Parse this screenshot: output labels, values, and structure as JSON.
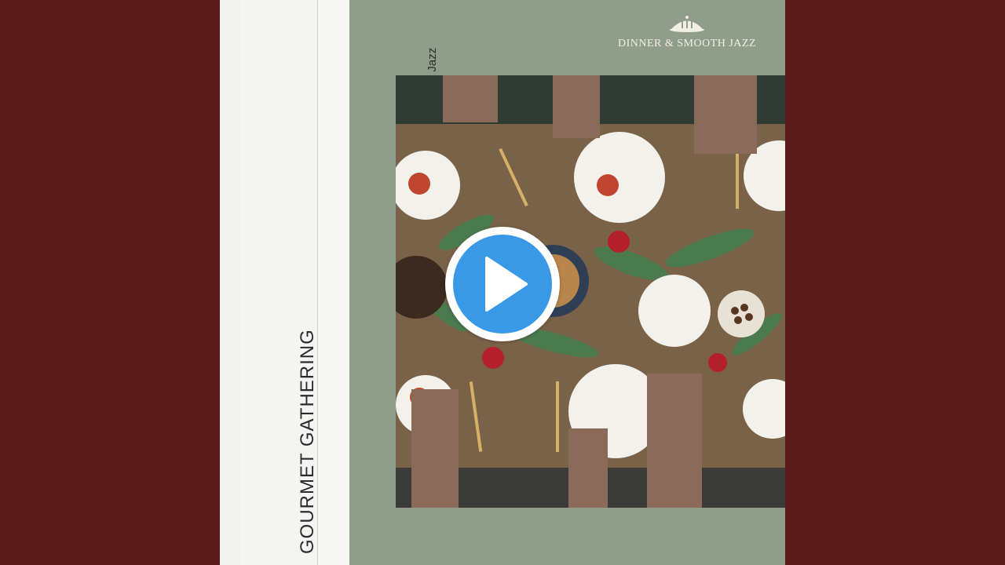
{
  "album": {
    "title": "GOURMET GATHERING",
    "artist": "Dinner & Smooth Jazz",
    "logo_text": "DINNER & SMOOTH JAZZ"
  },
  "icons": {
    "play": "play-icon",
    "logo": "cloche-icon"
  },
  "colors": {
    "background": "#5a1c1a",
    "cover": "#8f9d8a",
    "play_button": "#3a99e6"
  }
}
